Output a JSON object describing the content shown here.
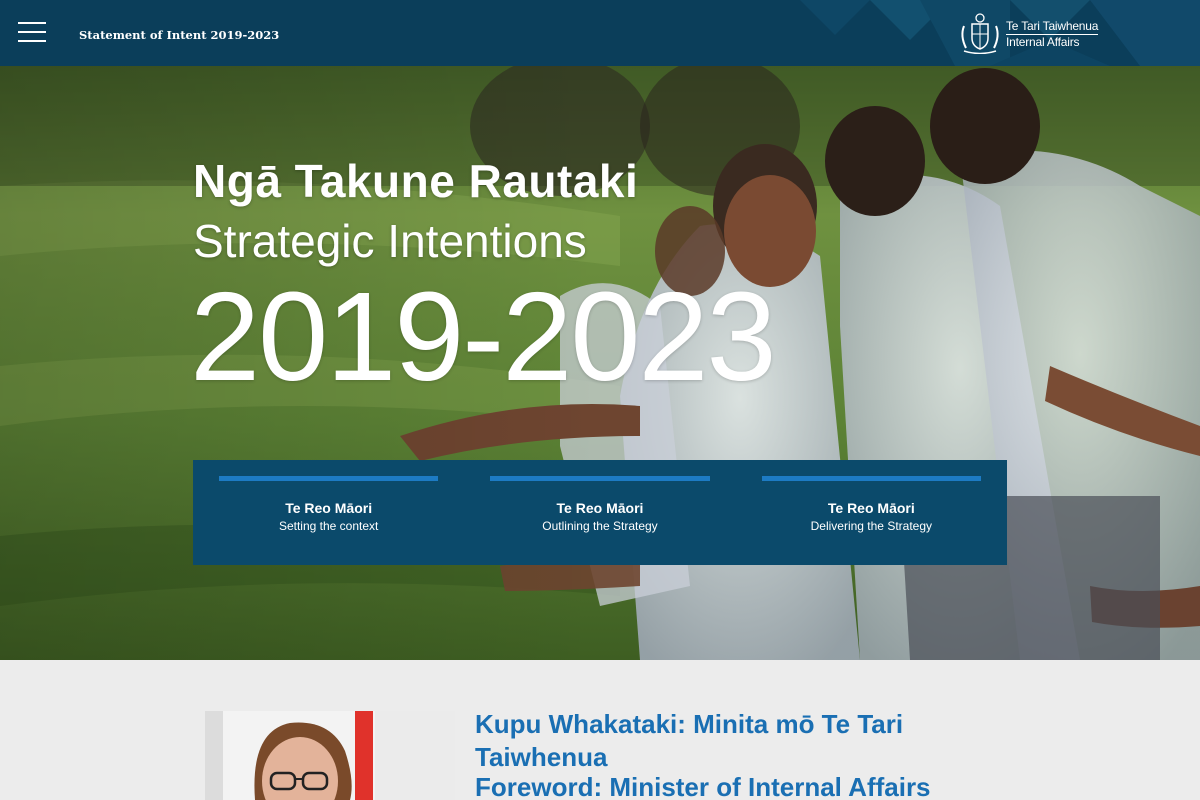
{
  "header": {
    "site_title": "Statement of Intent 2019-2023",
    "logo_line1": "Te Tari Taiwhenua",
    "logo_line2": "Internal Affairs",
    "menu_icon": "hamburger-menu-icon",
    "logo_icon": "nz-coat-of-arms-icon"
  },
  "hero": {
    "title_maori": "Ngā Takune Rautaki",
    "title_english": "Strategic Intentions",
    "years": "2019-2023",
    "sections": [
      {
        "title": "Te Reo Māori",
        "subtitle": "Setting the context"
      },
      {
        "title": "Te Reo Māori",
        "subtitle": "Outlining the Strategy"
      },
      {
        "title": "Te Reo Māori",
        "subtitle": "Delivering the Strategy"
      }
    ]
  },
  "foreword": {
    "heading_maori": "Kupu Whakataki: Minita mō Te Tari Taiwhenua",
    "heading_english": "Foreword: Minister of Internal Affairs"
  },
  "colors": {
    "header_bg": "#0b3e5a",
    "panel_bg": "#0b4a6b",
    "accent_bar": "#1d7bc4",
    "heading_blue": "#1a6fb3",
    "page_bg": "#ececec"
  }
}
